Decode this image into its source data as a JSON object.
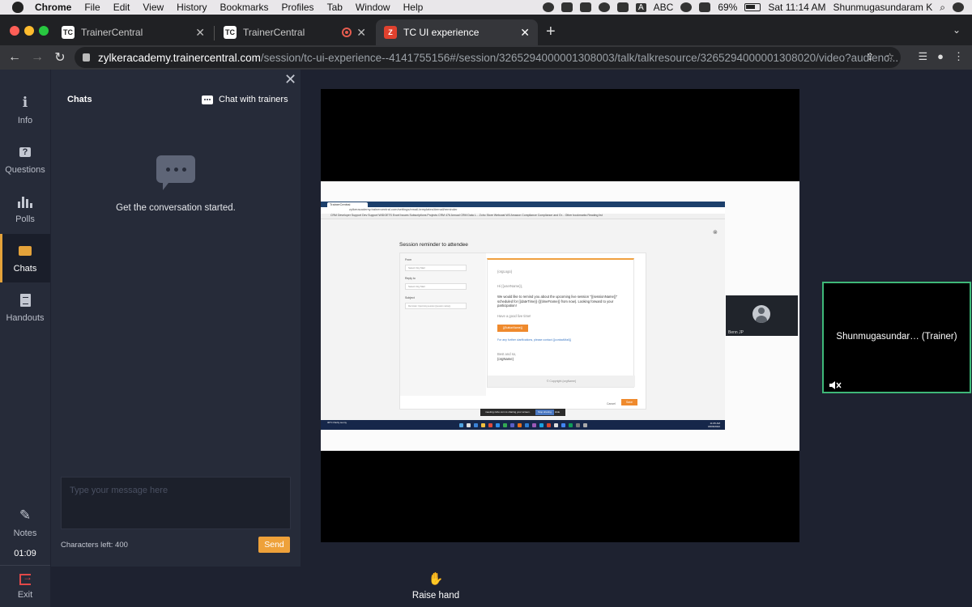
{
  "menubar": {
    "app": "Chrome",
    "items": [
      "File",
      "Edit",
      "View",
      "History",
      "Bookmarks",
      "Profiles",
      "Tab",
      "Window",
      "Help"
    ],
    "input_source": "ABC",
    "battery": "69%",
    "clock": "Sat 11:14 AM",
    "user": "Shunmugasundaram K"
  },
  "tabs": [
    {
      "title": "TrainerCentral",
      "favicon": "TC"
    },
    {
      "title": "TrainerCentral",
      "favicon": "TC"
    },
    {
      "title": "TC UI experience",
      "favicon": "Z"
    }
  ],
  "address": {
    "host": "zylkeracademy.trainercentral.com",
    "path": "/session/tc-ui-experience--4141755156#/session/3265294000001308003/talk/talkresource/3265294000001308020/video?audienc..."
  },
  "sidenav": {
    "items": [
      {
        "label": "Info",
        "icon": "info-icon"
      },
      {
        "label": "Questions",
        "icon": "question-icon"
      },
      {
        "label": "Polls",
        "icon": "poll-icon"
      },
      {
        "label": "Chats",
        "icon": "chat-icon"
      },
      {
        "label": "Handouts",
        "icon": "handout-icon"
      }
    ],
    "notes": "Notes",
    "timer": "01:09",
    "exit": "Exit"
  },
  "chat": {
    "title": "Chats",
    "trainers_link": "Chat with trainers",
    "empty_message": "Get the conversation started.",
    "input_placeholder": "Type your message here",
    "chars_left": "Characters left: 400",
    "send": "Send"
  },
  "shared_screen": {
    "tab_title": "TrainerCentral",
    "address": "zylkeracademy.trainercentral.com/settings/email-templates/#email/reminder",
    "bookmarks": "CRM   Developer   Support   Dev Support   WIDGETS   Excel   Issues   Subscriptions   Projects   CRM 476   Annual CRM Data L...   Zoho Store   Webcast   W3   Amazon   Compliance   Compliance and Gr...   Other bookmarks   Reading list",
    "dialog_title": "Session reminder to attendee",
    "from_label": "From",
    "from_value": "Select Org Mail",
    "reply_label": "Reply to",
    "reply_value": "Select Org Mail",
    "subject_label": "Subject",
    "subject_value": "Reminder: Upcoming session {{session name}}",
    "logo": "{orgLogo}",
    "greeting": "Hi {{userName}},",
    "body": "We would like to remind you about the upcoming live session \"{{sessionName}}\" scheduled for {{dateTime}} ({{timeFrame}} from now). Looking forward to your participation!",
    "join_hint": "Have a good live time!",
    "join_button": "{{ButtonName}}",
    "contact": "For any further clarifications, please contact {{contactMail}}",
    "signoff": "Best and so,",
    "signoff_name": "{orgName}",
    "footer": "© Copyright {orgName}",
    "cancel": "Cancel",
    "save": "Save",
    "share_banner": "meeting.zoho.com is sharing your screen.",
    "stop_sharing": "Stop sharing",
    "hide": "Hide",
    "weather": "30°C Partly sunny",
    "clock_time": "11:05 AM",
    "clock_date": "18/06/2022"
  },
  "participant_thumb": "Benn JP",
  "trainer_tile": "Shunmugasundar… (Trainer)",
  "raise_hand": "Raise hand",
  "colors": {
    "accent": "#EEA13A",
    "active_speaker": "#3FB878",
    "panel": "#262B39",
    "background": "#1E2230"
  }
}
